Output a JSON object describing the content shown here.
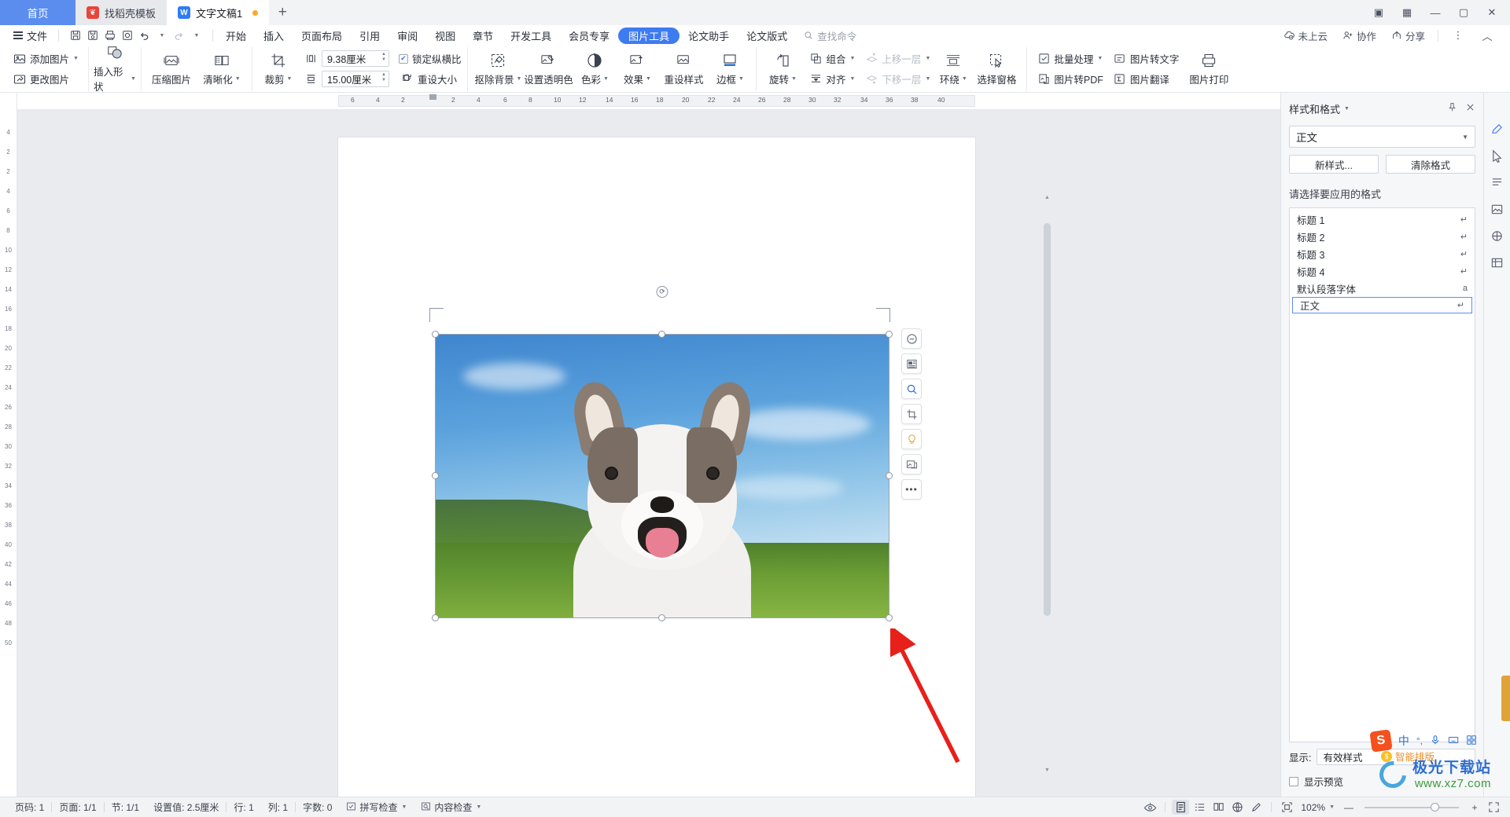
{
  "tabbar": {
    "home_label": "首页",
    "tabs": [
      {
        "label": "找稻壳模板",
        "icon": "dove-icon",
        "active": false,
        "modified": false
      },
      {
        "label": "文字文稿1",
        "icon": "wps-writer-icon",
        "active": true,
        "modified": true
      }
    ],
    "new_tab": "+",
    "window": {
      "restore_small": "▣",
      "grid": "▦",
      "minimize": "—",
      "maximize": "▢",
      "close": "✕"
    }
  },
  "menubar": {
    "file_label": "文件",
    "quick_actions": [
      "save-icon",
      "save-as-icon",
      "print-icon",
      "print-preview-icon",
      "undo-icon",
      "redo-icon",
      "customize-icon"
    ],
    "items": [
      {
        "label": "开始",
        "active": false
      },
      {
        "label": "插入",
        "active": false
      },
      {
        "label": "页面布局",
        "active": false
      },
      {
        "label": "引用",
        "active": false
      },
      {
        "label": "审阅",
        "active": false
      },
      {
        "label": "视图",
        "active": false
      },
      {
        "label": "章节",
        "active": false
      },
      {
        "label": "开发工具",
        "active": false
      },
      {
        "label": "会员专享",
        "active": false
      },
      {
        "label": "图片工具",
        "active": true
      },
      {
        "label": "论文助手",
        "active": false
      },
      {
        "label": "论文版式",
        "active": false
      }
    ],
    "search_placeholder": "查找命令",
    "right": [
      {
        "label": "未上云",
        "icon": "cloud-off-icon"
      },
      {
        "label": "协作",
        "icon": "collaborate-icon"
      },
      {
        "label": "分享",
        "icon": "share-icon"
      }
    ],
    "more": "⋮",
    "collapse": "︿"
  },
  "ribbon": {
    "groups": [
      {
        "name": "picture-source",
        "items": [
          {
            "label": "添加图片",
            "icon": "add-picture-icon",
            "caret": true,
            "disabled": false
          },
          {
            "label": "更改图片",
            "icon": "change-picture-icon",
            "caret": false,
            "disabled": false
          }
        ]
      },
      {
        "name": "insert-shape",
        "items": [
          {
            "label": "插入形状",
            "icon": "insert-shape-icon",
            "caret": true,
            "disabled": false
          }
        ]
      },
      {
        "name": "compress",
        "items": [
          {
            "label": "压缩图片",
            "icon": "compress-picture-icon",
            "caret": false,
            "disabled": false
          },
          {
            "label": "清晰化",
            "icon": "sharpen-icon",
            "caret": true,
            "disabled": false
          }
        ]
      },
      {
        "name": "crop-size",
        "crop_label": "裁剪",
        "width_value": "9.38厘米",
        "height_value": "15.00厘米",
        "lock_ratio_label": "锁定纵横比",
        "lock_ratio_checked": true,
        "reset_size_label": "重设大小"
      },
      {
        "name": "picture-edit",
        "items": [
          {
            "label": "抠除背景",
            "icon": "remove-background-icon",
            "caret": true
          },
          {
            "label": "设置透明色",
            "icon": "set-transparent-color-icon",
            "caret": false
          },
          {
            "label": "色彩",
            "icon": "color-icon",
            "caret": true
          },
          {
            "label": "效果",
            "icon": "effects-icon",
            "caret": true
          },
          {
            "label": "重设样式",
            "icon": "reset-style-icon",
            "caret": false
          },
          {
            "label": "边框",
            "icon": "border-icon",
            "caret": true
          }
        ]
      },
      {
        "name": "arrange",
        "items": [
          {
            "label": "旋转",
            "icon": "rotate-icon",
            "caret": true,
            "disabled": false
          },
          {
            "label": "组合",
            "icon": "group-icon",
            "caret": true,
            "disabled": false
          },
          {
            "label": "对齐",
            "icon": "align-icon",
            "caret": true,
            "disabled": false
          },
          {
            "label": "环绕",
            "icon": "text-wrap-icon",
            "caret": true,
            "disabled": false
          },
          {
            "label": "上移一层",
            "icon": "bring-forward-icon",
            "caret": true,
            "disabled": true
          },
          {
            "label": "下移一层",
            "icon": "send-backward-icon",
            "caret": true,
            "disabled": true
          },
          {
            "label": "选择窗格",
            "icon": "selection-pane-icon",
            "caret": false,
            "disabled": false
          }
        ]
      },
      {
        "name": "picture-convert",
        "items": [
          {
            "label": "批量处理",
            "icon": "batch-process-icon",
            "caret": true
          },
          {
            "label": "图片转PDF",
            "icon": "picture-to-pdf-icon",
            "caret": false
          },
          {
            "label": "图片转文字",
            "icon": "picture-to-text-icon",
            "caret": false
          },
          {
            "label": "图片翻译",
            "icon": "picture-translate-icon",
            "caret": false
          },
          {
            "label": "图片打印",
            "icon": "picture-print-icon",
            "caret": false
          }
        ]
      }
    ]
  },
  "rulers": {
    "horizontal": [
      "6",
      "4",
      "2",
      "2",
      "4",
      "6",
      "8",
      "10",
      "12",
      "14",
      "16",
      "18",
      "20",
      "22",
      "24",
      "26",
      "28",
      "30",
      "32",
      "34",
      "36",
      "38",
      "40"
    ],
    "vertical": [
      "4",
      "2",
      "2",
      "4",
      "6",
      "8",
      "10",
      "12",
      "14",
      "16",
      "18",
      "20",
      "22",
      "24",
      "26",
      "28",
      "30",
      "32",
      "34",
      "36",
      "38",
      "40",
      "42",
      "44",
      "46",
      "48",
      "50"
    ]
  },
  "canvas": {
    "image_alt": "husky-puppy-photo",
    "layout_button": "layout-options-icon",
    "float_tools": [
      {
        "icon": "minus-circle-icon",
        "name": "shrink-button"
      },
      {
        "icon": "layout-inline-icon",
        "name": "wrap-text-button"
      },
      {
        "icon": "search-icon",
        "name": "zoom-picture-button"
      },
      {
        "icon": "crop-icon",
        "name": "crop-button"
      },
      {
        "icon": "bulb-icon",
        "name": "smart-effect-button"
      },
      {
        "icon": "picture-swap-icon",
        "name": "change-picture-button"
      },
      {
        "icon": "more-icon",
        "name": "more-options-button"
      }
    ],
    "annotation": "red-arrow-annotation"
  },
  "style_panel": {
    "title": "样式和格式",
    "pin_icon": "pin-icon",
    "close_icon": "close-icon",
    "current_style": "正文",
    "new_style_label": "新样式...",
    "clear_format_label": "清除格式",
    "list_caption": "请选择要应用的格式",
    "styles": [
      {
        "label": "标题 1",
        "mark": "↵",
        "selected": false
      },
      {
        "label": "标题 2",
        "mark": "↵",
        "selected": false
      },
      {
        "label": "标题 3",
        "mark": "↵",
        "selected": false
      },
      {
        "label": "标题 4",
        "mark": "↵",
        "selected": false
      },
      {
        "label": "默认段落字体",
        "mark": "a",
        "selected": false
      },
      {
        "label": "正文",
        "mark": "↵",
        "selected": true
      }
    ],
    "show_label": "显示:",
    "show_value": "有效样式",
    "preview_label": "显示预览",
    "preview_checked": false
  },
  "rail": {
    "icons": [
      "pen-edit-icon",
      "cursor-select-icon",
      "paragraph-icon",
      "picture-panel-icon",
      "shape-panel-icon",
      "table-panel-icon"
    ]
  },
  "status": {
    "left": [
      {
        "label": "页码: 1",
        "name": "page-number"
      },
      {
        "label": "页面: 1/1",
        "name": "page-of"
      },
      {
        "label": "节: 1/1",
        "name": "section"
      },
      {
        "label": "设置值: 2.5厘米",
        "name": "margin-value"
      },
      {
        "label": "行: 1",
        "name": "row"
      },
      {
        "label": "列: 1",
        "name": "column"
      },
      {
        "label": "字数: 0",
        "name": "word-count"
      },
      {
        "label": "拼写检查",
        "name": "spell-check",
        "icon": "spellcheck-icon",
        "caret": true
      },
      {
        "label": "内容检查",
        "name": "content-check",
        "icon": "content-check-icon",
        "caret": true
      }
    ],
    "view_icons": [
      {
        "name": "eye-icon",
        "glyph": "◉",
        "active": false
      },
      {
        "name": "page-view-icon",
        "glyph": "▤",
        "active": true
      },
      {
        "name": "outline-view-icon",
        "glyph": "☰",
        "active": false
      },
      {
        "name": "reading-view-icon",
        "glyph": "▯",
        "active": false
      },
      {
        "name": "web-view-icon",
        "glyph": "⊕",
        "active": false
      },
      {
        "name": "pen-view-icon",
        "glyph": "✎",
        "active": false
      }
    ],
    "fit_icon": "fit-page-icon",
    "zoom_value": "102%",
    "zoom_minus": "—",
    "zoom_plus": "+",
    "fullscreen_icon": "fullscreen-icon"
  },
  "overlay": {
    "ime_s": "S",
    "ime_mode": "中",
    "ime_punct": "°,",
    "ime_mic": "🎤",
    "smart_layout": "智能排版",
    "watermark_line1": "极光下载站",
    "watermark_line2": "www.xz7.com"
  }
}
